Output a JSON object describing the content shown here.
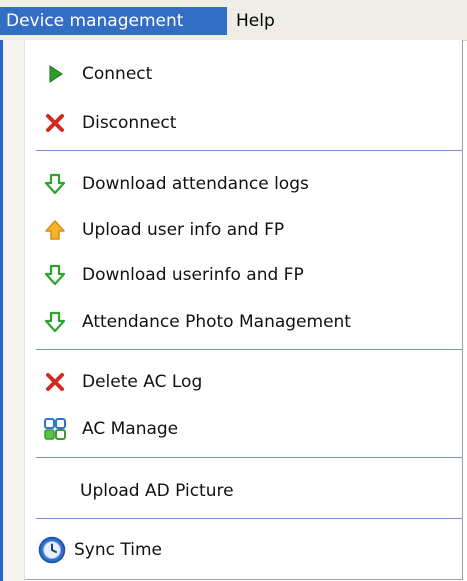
{
  "menubar": {
    "items": [
      {
        "label": "Device management"
      },
      {
        "label": "Help"
      }
    ]
  },
  "menu": {
    "items": [
      {
        "label": "Connect",
        "icon": "connect-play-icon"
      },
      {
        "label": "Disconnect",
        "icon": "disconnect-x-icon"
      },
      {
        "label": "Download attendance logs",
        "icon": "download-arrow-icon"
      },
      {
        "label": "Upload user info and FP",
        "icon": "upload-arrow-icon"
      },
      {
        "label": "Download userinfo and FP",
        "icon": "download-arrow-icon"
      },
      {
        "label": "Attendance Photo Management",
        "icon": "download-arrow-icon"
      },
      {
        "label": "Delete AC Log",
        "icon": "delete-x-icon"
      },
      {
        "label": "AC Manage",
        "icon": "ac-manage-grid-icon"
      },
      {
        "label": "Upload AD Picture",
        "icon": ""
      },
      {
        "label": "Sync Time",
        "icon": "clock-icon"
      }
    ]
  },
  "colors": {
    "menubar_bg": "#efeee6",
    "menubar_active": "#326ec5",
    "separator": "#6f94cf",
    "download_green": "#2fa32f",
    "upload_orange": "#f3a21a",
    "delete_red": "#d02b22"
  }
}
